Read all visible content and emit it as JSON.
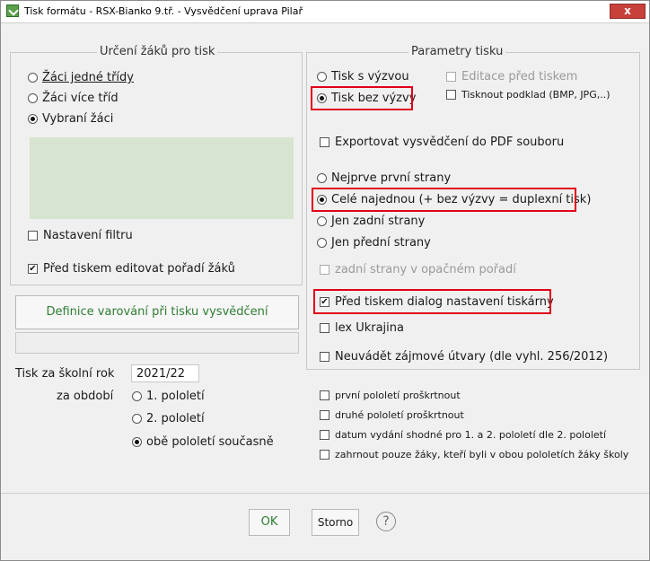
{
  "window": {
    "title": "Tisk formátu - RSX-Bianko 9.tř. - Vysvědčení uprava Pilař",
    "close_label": "x"
  },
  "left_group": {
    "legend": "Určení žáků pro tisk",
    "options": [
      {
        "label": "Žáci jedné třídy",
        "selected": false
      },
      {
        "label": "Žáci více tříd",
        "selected": false
      },
      {
        "label": "Vybraní žáci",
        "selected": true
      }
    ],
    "filter_label": "Nastavení filtru",
    "filter_checked": false,
    "edit_order_label": "Před tiskem editovat pořadí žáků",
    "edit_order_checked": true
  },
  "definice_button": "Definice varování při tisku vysvědčení",
  "year": {
    "label": "Tisk za školní rok",
    "value": "2021/22"
  },
  "period": {
    "label": "za období",
    "options": [
      {
        "label": "1. pololetí",
        "selected": false
      },
      {
        "label": "2. pololetí",
        "selected": false
      },
      {
        "label": "obě pololetí současně",
        "selected": true
      }
    ]
  },
  "params": {
    "legend": "Parametry tisku",
    "tisk_s_vyzvou": "Tisk s výzvou",
    "tisk_bez_vyzvy": "Tisk bez výzvy",
    "editace": "Editace před tiskem",
    "podklad": "Tisknout podklad (BMP, JPG,..)",
    "export_pdf": "Exportovat vysvědčení do PDF souboru",
    "nejprve": "Nejprve první strany",
    "cele": "Celé najednou (+ bez výzvy = duplexní tisk)",
    "zadni": "Jen zadní strany",
    "predni": "Jen přední strany",
    "opacne": "zadní strany v opačném pořadí",
    "dialog": "Před tiskem dialog nastavení tiskárny",
    "lex": "lex Ukrajina",
    "neuvadet": "Neuvádět zájmové útvary (dle vyhl. 256/2012)"
  },
  "extra": {
    "prvni": "první pololetí proškrtnout",
    "druhe": "druhé pololetí proškrtnout",
    "datum": "datum vydání shodné pro 1. a 2. pololetí dle 2. pololetí",
    "zahrnout": "zahrnout pouze žáky, kteří byli v obou pololetích žáky školy"
  },
  "buttons": {
    "ok": "OK",
    "storno": "Storno",
    "help": "?"
  }
}
